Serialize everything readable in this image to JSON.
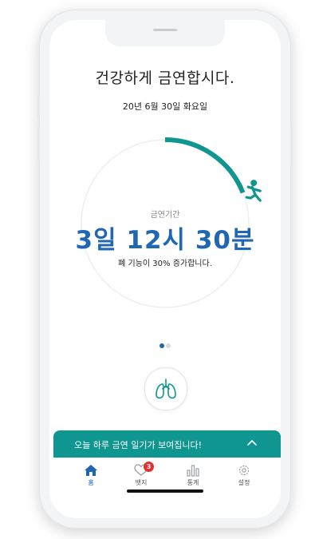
{
  "header": {
    "title": "건강하게 금연합시다.",
    "date": "20년 6월 30일 화요일"
  },
  "progress": {
    "label": "금연기간",
    "time": "3일 12시 30분",
    "fraction": 0.19,
    "message": "폐 기능이 30% 증가합니다."
  },
  "pager": {
    "count": 2,
    "active": 0
  },
  "diary": {
    "text": "오늘 하루 금연 일기가 보여집니다!",
    "icon": "chevron-up-icon"
  },
  "tabs": [
    {
      "label": "홈",
      "icon": "home-icon",
      "active": true
    },
    {
      "label": "뱃지",
      "icon": "heart-icon",
      "active": false,
      "badge": "3"
    },
    {
      "label": "통계",
      "icon": "bar-chart-icon",
      "active": false
    },
    {
      "label": "설정",
      "icon": "gear-icon",
      "active": false
    }
  ],
  "colors": {
    "accent": "#0f9691",
    "time_text": "#1f66b3",
    "tab_active": "#1f66b3",
    "tab_inactive": "#9aa0a6",
    "badge": "#e03131"
  }
}
